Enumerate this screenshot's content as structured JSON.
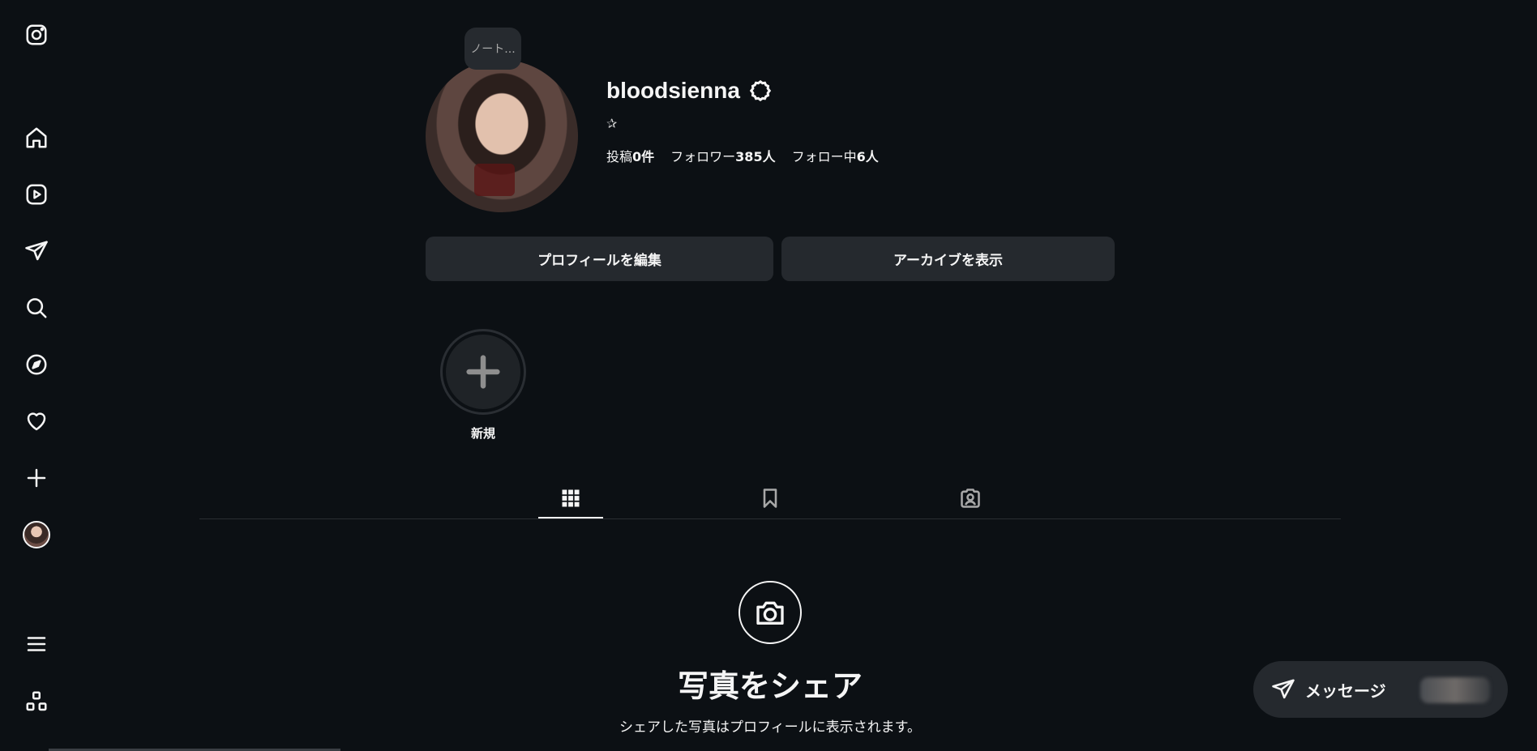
{
  "sidebar": {
    "items": [
      {
        "name": "instagram-logo",
        "icon": "instagram-icon"
      },
      {
        "name": "home",
        "icon": "home-icon"
      },
      {
        "name": "reels",
        "icon": "reels-icon"
      },
      {
        "name": "messages",
        "icon": "send-icon"
      },
      {
        "name": "search",
        "icon": "search-icon"
      },
      {
        "name": "explore",
        "icon": "compass-icon"
      },
      {
        "name": "notifications",
        "icon": "heart-icon"
      },
      {
        "name": "create",
        "icon": "plus-icon"
      },
      {
        "name": "profile",
        "icon": "avatar"
      },
      {
        "name": "more",
        "icon": "menu-icon"
      },
      {
        "name": "also-from-meta",
        "icon": "apps-icon"
      }
    ]
  },
  "profile": {
    "note": "ノート...",
    "username": "bloodsienna",
    "bio": "✰",
    "stats": {
      "posts_label": "投稿",
      "posts_count": "0件",
      "followers_label": "フォロワー",
      "followers_count": "385人",
      "following_label": "フォロー中",
      "following_count": "6人"
    },
    "edit_button": "プロフィールを編集",
    "archive_button": "アーカイブを表示",
    "new_highlight_label": "新規"
  },
  "tabs": [
    {
      "name": "posts",
      "icon": "grid-icon",
      "active": true
    },
    {
      "name": "saved",
      "icon": "bookmark-icon",
      "active": false
    },
    {
      "name": "tagged",
      "icon": "tagged-icon",
      "active": false
    }
  ],
  "empty_state": {
    "icon": "camera-icon",
    "title": "写真をシェア",
    "subtitle": "シェアした写真はプロフィールに表示されます。"
  },
  "messages_pill": {
    "label": "メッセージ"
  },
  "colors": {
    "background": "#0c1014",
    "button": "#25292e",
    "text": "#f5f5f5",
    "muted": "#a8a8a8"
  }
}
